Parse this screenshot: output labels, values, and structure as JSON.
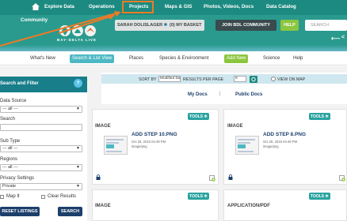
{
  "topnav": {
    "items": [
      "Explore Data",
      "Operations",
      "Projects",
      "Maps & GIS",
      "Photos, Videos, Docs",
      "Data Catalog"
    ],
    "community": "Community"
  },
  "header": {
    "logo_text": "BAY·DELTA LIVE",
    "user_label": "SARAH DOLISLAGER",
    "basket_label": "(0) MY BASKET",
    "join_label": "JOIN BDL COMMUNITY",
    "help_label": "HELP",
    "search_placeholder": "SEARCH"
  },
  "subnav": {
    "tabs": [
      "What's New",
      "Search & List View",
      "Places",
      "Species & Environment",
      "Add New",
      "Science",
      "Help"
    ],
    "active": "Search & List View"
  },
  "left_panel": {
    "title": "Search and Filter",
    "help": "?",
    "data_source_label": "Data Source",
    "data_source_value": "--- all ---",
    "search_label": "Search",
    "subtype_label": "Sub Type",
    "subtype_value": "--- all ---",
    "regions_label": "Regions",
    "regions_value": "--- all ---",
    "privacy_label": "Privacy Settings",
    "privacy_value": "Private",
    "map_it_label": "Map It",
    "clear_results_label": "Clear Results",
    "reset_label": "RESET LISTINGS",
    "search_button": "SEARCH"
  },
  "sortbar": {
    "sort_by_label": "SORT BY",
    "sort_value": "Modified Da",
    "results_label": "RESULTS PER PAGE",
    "results_value": "6",
    "view_on_map_label": "VIEW ON MAP"
  },
  "doc_links": {
    "my_docs": "My Docs",
    "divider": "|",
    "public_docs": "Public Docs"
  },
  "cards": [
    {
      "type": "IMAGE",
      "title": "ADD STEP 10.PNG",
      "date": "Oct 28, 2015 04:49 PM",
      "mime": "image/png",
      "tools": "TOOLS"
    },
    {
      "type": "IMAGE",
      "title": "ADD STEP 8.PNG",
      "date": "Oct 28, 2015 04:49 PM",
      "mime": "image/png",
      "tools": "TOOLS"
    },
    {
      "type": "IMAGE",
      "tools": "TOOLS"
    },
    {
      "type": "APPLICATION/PDF",
      "tools": "TOOLS"
    }
  ],
  "colors": {
    "nav": "#1c8a80",
    "header": "#2a9a8e",
    "accent_orange": "#ee7a25",
    "active_tab": "#4cb8c4",
    "green": "#8cc63f",
    "navy": "#1c3f6b"
  }
}
